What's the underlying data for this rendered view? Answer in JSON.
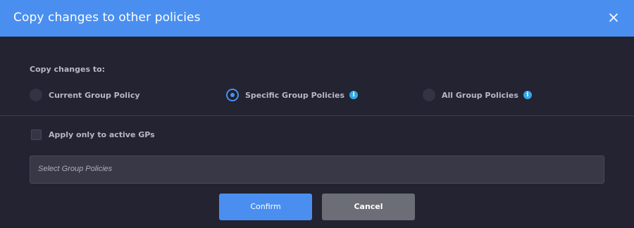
{
  "dialog": {
    "title": "Copy changes to other policies",
    "close_icon": "close-icon",
    "header_color": "#4a8ff0"
  },
  "copy_to": {
    "label": "Copy changes to:",
    "options": [
      {
        "label": "Current Group Policy",
        "selected": false,
        "has_info": false
      },
      {
        "label": "Specific Group Policies",
        "selected": true,
        "has_info": true,
        "info_icon": "info-icon"
      },
      {
        "label": "All Group Policies",
        "selected": false,
        "has_info": true,
        "info_icon": "info-icon"
      }
    ]
  },
  "active_only": {
    "label": "Apply only to active GPs",
    "checked": false
  },
  "group_select": {
    "placeholder": "Select Group Policies"
  },
  "buttons": {
    "confirm_label": "Confirm",
    "cancel_label": "Cancel"
  },
  "colors": {
    "accent": "#4a8ff0",
    "info": "#33a7e6",
    "background": "#232331"
  }
}
